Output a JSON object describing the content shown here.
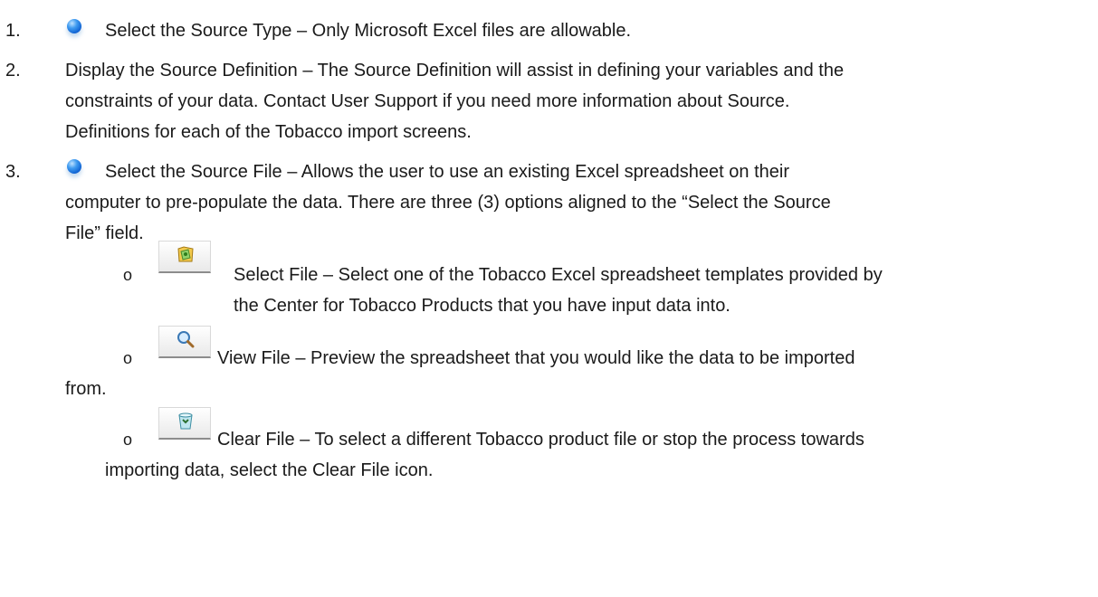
{
  "steps": [
    {
      "number": "1.",
      "icon": "blue-dot-icon",
      "lines": [
        "Select the Source Type – Only Microsoft Excel files are allowable."
      ]
    },
    {
      "number": "2.",
      "lines": [
        "Display the Source Definition – The Source Definition will assist in defining your variables and the",
        "constraints of your data.  Contact User Support if you need more information about Source.",
        "Definitions for each of the Tobacco import screens."
      ]
    },
    {
      "number": "3.",
      "icon": "blue-dot-icon",
      "lines": [
        "Select the Source File – Allows the user to use an existing Excel spreadsheet on their",
        "computer to pre-populate the data.  There are three (3) options aligned to the “Select the Source",
        "File” field."
      ]
    }
  ],
  "options": [
    {
      "bullet": "o",
      "icon": "select-file-icon",
      "lines": [
        "Select File – Select one of the Tobacco Excel spreadsheet templates provided by",
        "the Center for Tobacco Products that you have input data into."
      ]
    },
    {
      "bullet": "o",
      "icon": "view-file-icon",
      "lines": [
        "View File – Preview the spreadsheet that you would like the data to be imported",
        "from."
      ]
    },
    {
      "bullet": "o",
      "icon": "clear-file-icon",
      "lines": [
        "Clear File – To select a different Tobacco product file or stop the process towards",
        "importing data, select the Clear File icon."
      ]
    }
  ]
}
